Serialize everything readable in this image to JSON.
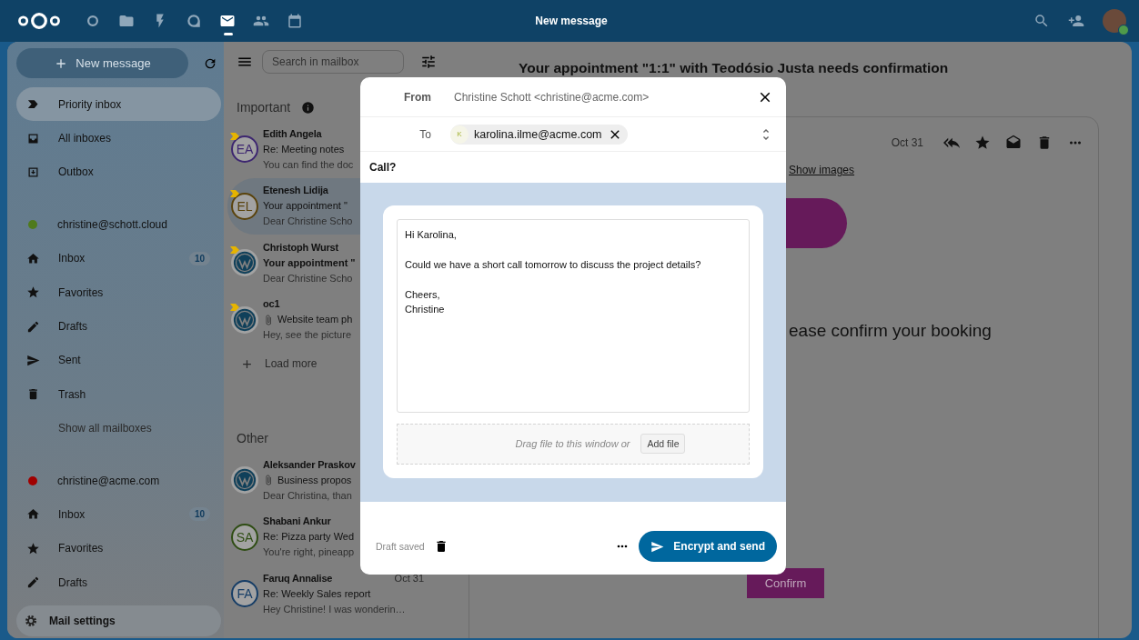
{
  "header": {
    "title": "New message",
    "apps": [
      {
        "selected": false
      },
      {
        "selected": false
      },
      {
        "selected": false
      },
      {
        "selected": false
      },
      {
        "selected": true
      },
      {
        "selected": false
      },
      {
        "selected": false
      }
    ]
  },
  "sidebar": {
    "new_message": "New message",
    "items": [
      {
        "kind": "nav",
        "label": "Priority inbox",
        "selected": true
      },
      {
        "kind": "nav",
        "label": "All inboxes",
        "selected": false
      },
      {
        "kind": "nav",
        "label": "Outbox",
        "selected": false
      },
      {
        "kind": "account",
        "label": "christine@schott.cloud",
        "color": "#4f7a1c"
      },
      {
        "kind": "nav",
        "label": "Inbox",
        "count": "10",
        "selected": false
      },
      {
        "kind": "nav",
        "label": "Favorites",
        "selected": false
      },
      {
        "kind": "nav",
        "label": "Drafts",
        "selected": false
      },
      {
        "kind": "nav",
        "label": "Sent",
        "selected": false
      },
      {
        "kind": "nav",
        "label": "Trash",
        "selected": false
      },
      {
        "kind": "more",
        "label": "Show all mailboxes"
      },
      {
        "kind": "account",
        "label": "christine@acme.com",
        "color": "#a00000"
      },
      {
        "kind": "nav",
        "label": "Inbox",
        "count": "10",
        "selected": false
      },
      {
        "kind": "nav",
        "label": "Favorites",
        "selected": false
      },
      {
        "kind": "nav",
        "label": "Drafts",
        "selected": false
      }
    ],
    "settings": "Mail settings"
  },
  "list": {
    "search": {
      "placeholder": "Search in mailbox"
    },
    "sections": [
      {
        "title": "Important",
        "info": true,
        "load_more": "Load more",
        "messages": [
          {
            "sender": "Edith Angela",
            "subject": "Re: Meeting notes",
            "preview": "You can find the doc",
            "avatar": {
              "kind": "initials",
              "text": "EA",
              "color": "#3d2670"
            },
            "important": true,
            "selected": false,
            "unread": false,
            "attachment": false
          },
          {
            "sender": "Etenesh Lidija",
            "subject": "Your appointment \"",
            "preview": "Dear Christine Scho",
            "avatar": {
              "kind": "initials",
              "text": "EL",
              "color": "#5a430c"
            },
            "important": true,
            "selected": true,
            "unread": false,
            "attachment": false
          },
          {
            "sender": "Christoph Wurst",
            "subject": "Your appointment \"",
            "preview": "Dear Christine Scho",
            "avatar": {
              "kind": "logo"
            },
            "important": true,
            "selected": false,
            "unread": true,
            "attachment": false
          },
          {
            "sender": "oc1",
            "subject": "Website team ph",
            "preview": "Hey, see the picture",
            "avatar": {
              "kind": "logo"
            },
            "important": true,
            "selected": false,
            "unread": false,
            "attachment": true
          }
        ]
      },
      {
        "title": "Other",
        "info": false,
        "messages": [
          {
            "sender": "Aleksander Praskov",
            "subject": "Business propos",
            "preview": "Dear Christina, than",
            "avatar": {
              "kind": "logo"
            },
            "important": false,
            "selected": false,
            "unread": false,
            "attachment": true
          },
          {
            "sender": "Shabani Ankur",
            "subject": "Re: Pizza party Wed",
            "preview": "You're right, pineapp",
            "avatar": {
              "kind": "initials",
              "text": "SA",
              "color": "#2f4d14"
            },
            "important": false,
            "selected": false,
            "unread": false,
            "attachment": false
          },
          {
            "sender": "Faruq Annalise",
            "date": "Oct 31",
            "subject": "Re: Weekly Sales report",
            "preview": "Hey Christine! I was wonderin…",
            "avatar": {
              "kind": "initials",
              "text": "FA",
              "color": "#163d66"
            },
            "important": false,
            "selected": false,
            "unread": false,
            "attachment": false
          }
        ]
      }
    ]
  },
  "message": {
    "title": "Your appointment \"1:1\" with Teodósio Justa needs confirmation",
    "date": "Oct 31",
    "show_images": "Show images",
    "heading": "ease confirm your booking",
    "confirm": "Confirm"
  },
  "composer": {
    "from_label": "From",
    "from": "Christine Schott <christine@acme.com>",
    "to_label": "To",
    "recipients": [
      {
        "initial": "K",
        "address": "karolina.ilme@acme.com"
      }
    ],
    "subject": "Call?",
    "body": [
      [
        "Hi Karolina,"
      ],
      [
        "Could we have a short call tomorrow to discuss the project details?"
      ],
      [
        "Cheers,",
        "Christine"
      ]
    ],
    "drop_hint": "Drag file to this window or",
    "add_file": "Add file",
    "draft_status": "Draft saved",
    "send": "Encrypt and send"
  }
}
